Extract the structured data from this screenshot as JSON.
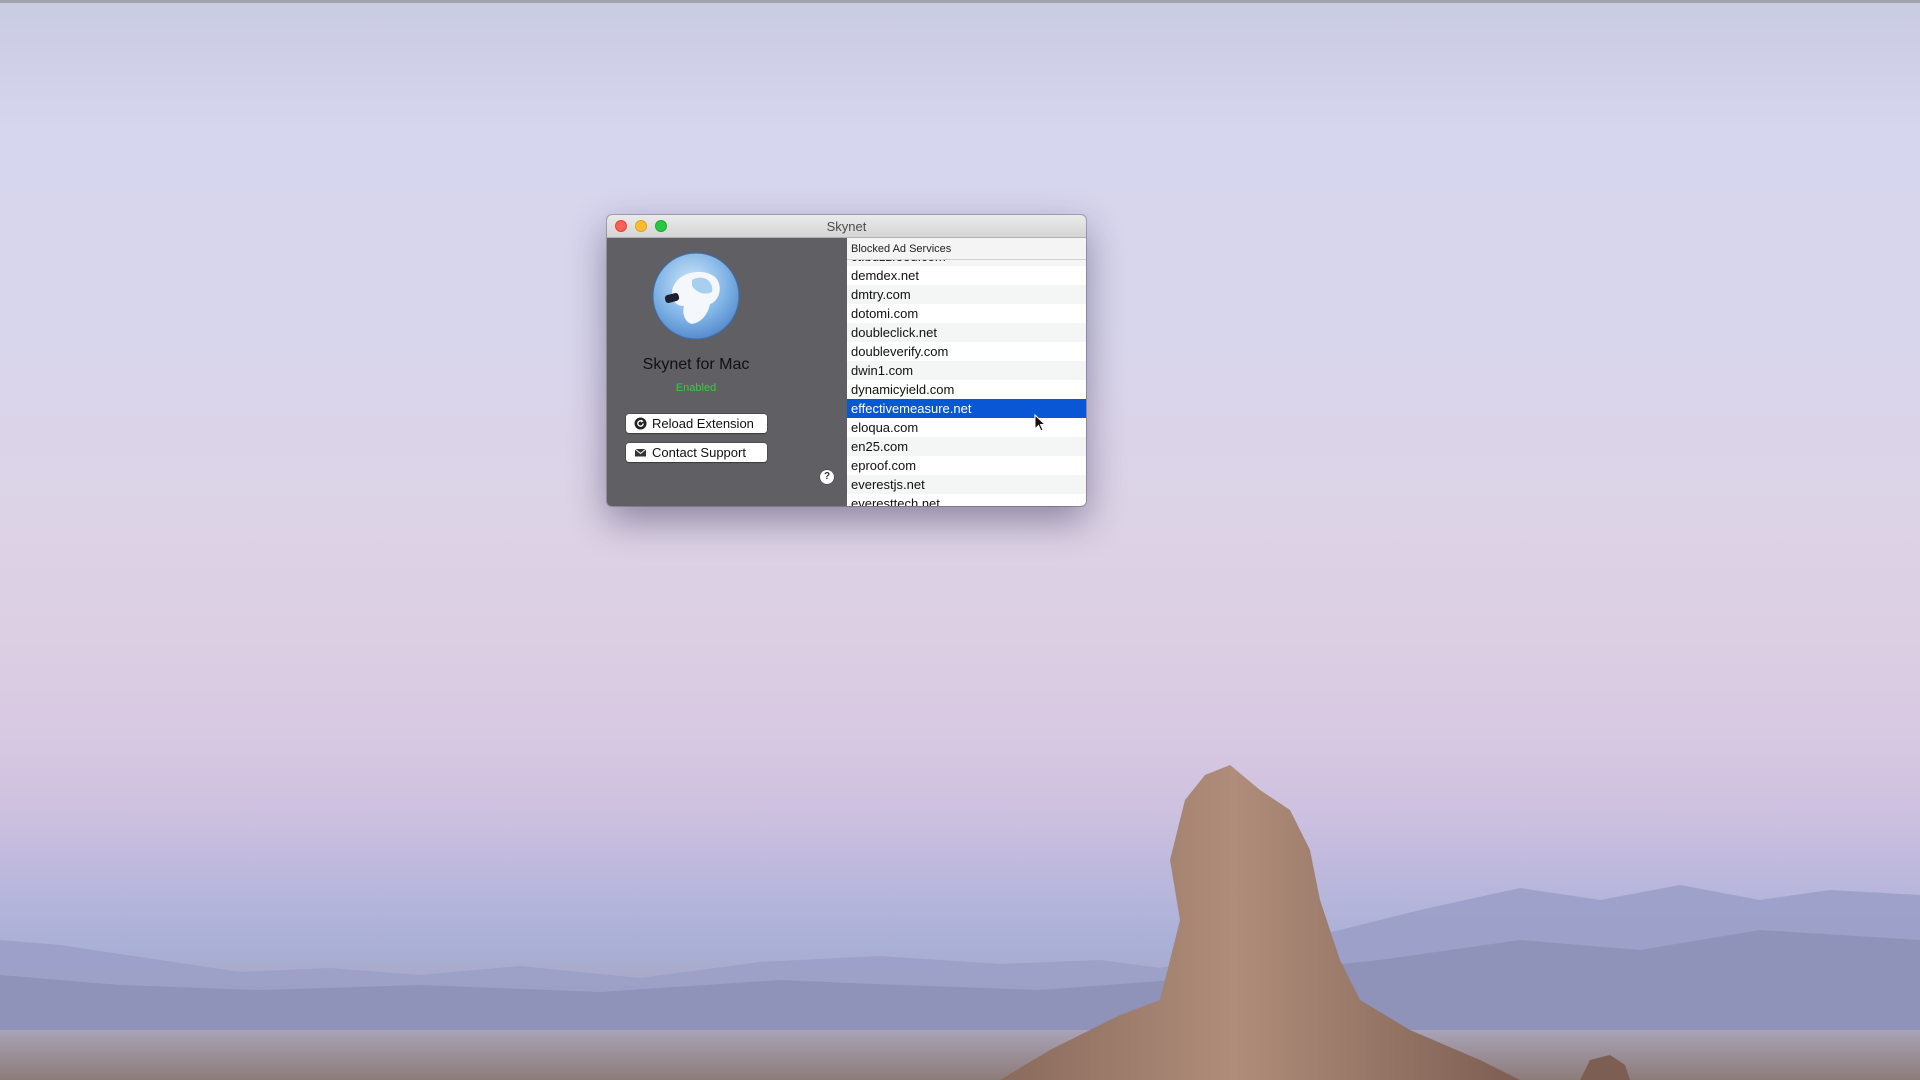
{
  "window": {
    "title": "Skynet",
    "app_name": "Skynet for Mac",
    "status": "Enabled",
    "status_color": "#2ed23a"
  },
  "buttons": {
    "reload": "Reload Extension",
    "contact": "Contact Support",
    "help": "?"
  },
  "list": {
    "header": "Blocked Ad Services",
    "items": [
      "ct.buzzfeed.com",
      "demdex.net",
      "dmtry.com",
      "dotomi.com",
      "doubleclick.net",
      "doubleverify.com",
      "dwin1.com",
      "dynamicyield.com",
      "effectivemeasure.net",
      "eloqua.com",
      "en25.com",
      "eproof.com",
      "everestjs.net",
      "everesttech.net"
    ],
    "selected": "effectivemeasure.net",
    "selection_color": "#0a57d6"
  },
  "icons": {
    "reload": "reload-icon",
    "contact": "envelope-icon",
    "logo": "skynet-logo"
  }
}
